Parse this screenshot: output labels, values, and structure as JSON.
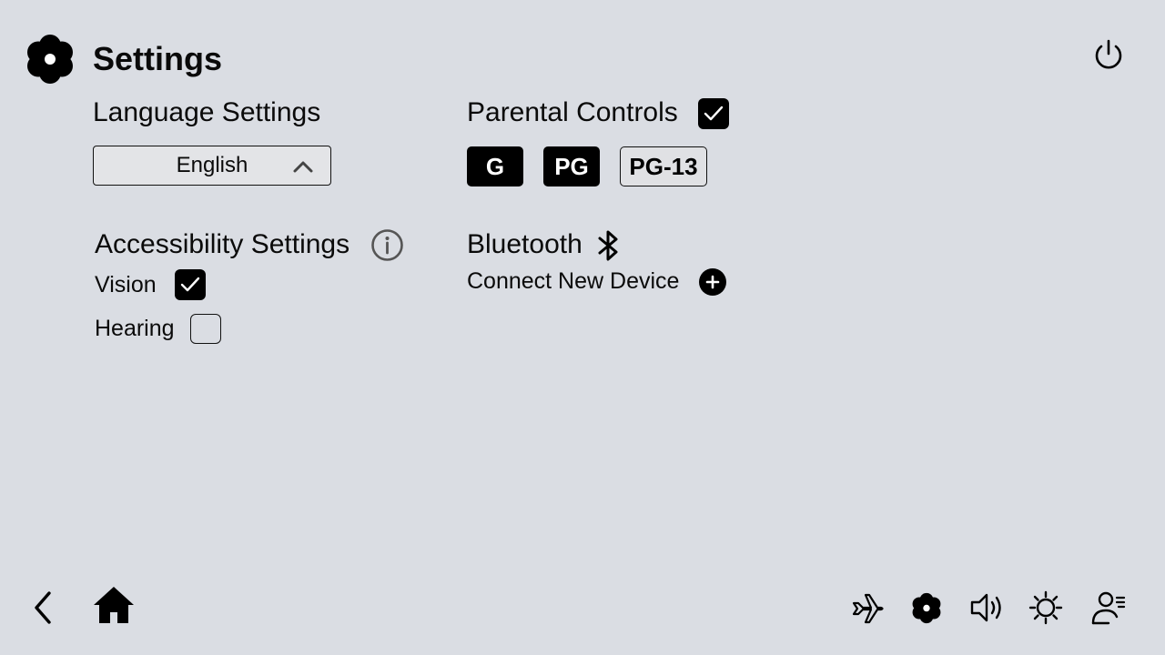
{
  "header": {
    "title": "Settings",
    "settings_icon": "gear-icon",
    "power_icon": "power-icon"
  },
  "language": {
    "title": "Language Settings",
    "selected": "English",
    "chevron_icon": "chevron-up-icon"
  },
  "parental": {
    "title": "Parental Controls",
    "enabled": true,
    "ratings": [
      {
        "label": "G",
        "selected": true
      },
      {
        "label": "PG",
        "selected": true
      },
      {
        "label": "PG-13",
        "selected": false
      }
    ]
  },
  "accessibility": {
    "title": "Accessibility Settings",
    "info_icon": "info-icon",
    "options": [
      {
        "label": "Vision",
        "checked": true
      },
      {
        "label": "Hearing",
        "checked": false
      }
    ]
  },
  "bluetooth": {
    "title": "Bluetooth",
    "connect_label": "Connect New Device",
    "icon": "bluetooth-icon",
    "add_icon": "plus-circle-icon"
  },
  "bottom_nav": {
    "left": [
      "back-icon",
      "home-icon"
    ],
    "right": [
      "airplane-icon",
      "gear-icon",
      "volume-icon",
      "brightness-icon",
      "user-settings-icon"
    ]
  },
  "colors": {
    "background": "#dadde3",
    "accent": "#000000",
    "unselected": "#e0e1e4"
  }
}
